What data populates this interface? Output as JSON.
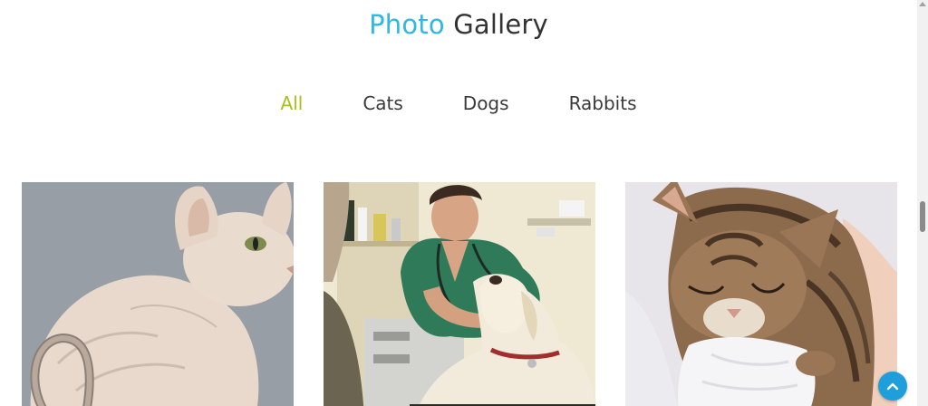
{
  "header": {
    "title_accent": "Photo",
    "title_rest": "Gallery",
    "accent_color": "#2fb8e0"
  },
  "filters": {
    "items": [
      {
        "label": "All",
        "active": true
      },
      {
        "label": "Cats",
        "active": false
      },
      {
        "label": "Dogs",
        "active": false
      },
      {
        "label": "Rabbits",
        "active": false
      }
    ],
    "active_color": "#a8c017"
  },
  "gallery": {
    "photos": [
      {
        "subject": "hairless sphynx cat",
        "category": "Cats"
      },
      {
        "subject": "veterinarian examining labrador dog",
        "category": "Dogs"
      },
      {
        "subject": "sleeping tabby kitten",
        "category": "Cats"
      }
    ]
  },
  "back_to_top": {
    "icon": "chevron-up-icon",
    "color": "#1e9fdb"
  }
}
